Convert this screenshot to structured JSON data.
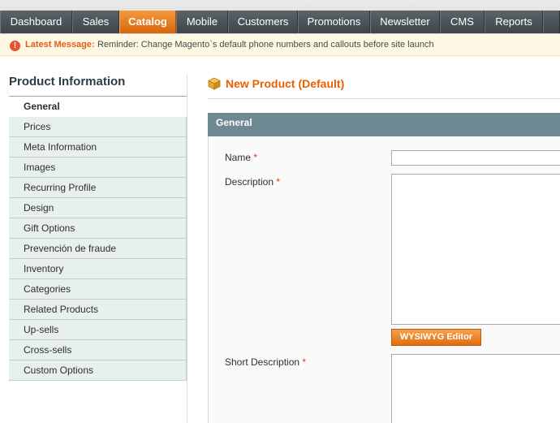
{
  "nav": {
    "items": [
      "Dashboard",
      "Sales",
      "Catalog",
      "Mobile",
      "Customers",
      "Promotions",
      "Newsletter",
      "CMS",
      "Reports"
    ],
    "active": "Catalog"
  },
  "message": {
    "icon": "alert-icon",
    "label": "Latest Message:",
    "text": "Reminder: Change Magento`s default phone numbers and callouts before site launch"
  },
  "sidebar": {
    "title": "Product Information",
    "tabs": [
      "General",
      "Prices",
      "Meta Information",
      "Images",
      "Recurring Profile",
      "Design",
      "Gift Options",
      "Prevención de fraude",
      "Inventory",
      "Categories",
      "Related Products",
      "Up-sells",
      "Cross-sells",
      "Custom Options"
    ],
    "active": "General"
  },
  "main": {
    "title": "New Product (Default)",
    "section": "General",
    "fields": {
      "name_label": "Name",
      "description_label": "Description",
      "short_description_label": "Short Description",
      "required_mark": "*"
    },
    "wysiwyg_button": "WYSIWYG Editor"
  },
  "colors": {
    "accent": "#eb5e00",
    "nav_bg": "#4a5357",
    "section_head": "#6f8992",
    "tab_bg": "#e7efef"
  }
}
